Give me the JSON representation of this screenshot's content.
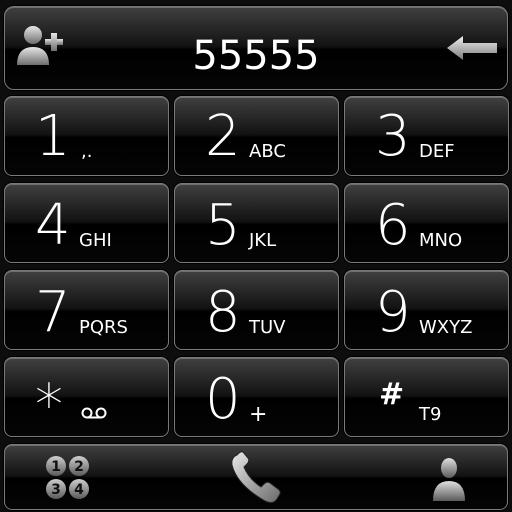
{
  "display": {
    "number": "55555",
    "add_contact_icon": "add-contact-icon",
    "backspace_icon": "backspace-arrow-icon"
  },
  "keys": [
    {
      "digit": "1",
      "letters": ",."
    },
    {
      "digit": "2",
      "letters": "ABC"
    },
    {
      "digit": "3",
      "letters": "DEF"
    },
    {
      "digit": "4",
      "letters": "GHI"
    },
    {
      "digit": "5",
      "letters": "JKL"
    },
    {
      "digit": "6",
      "letters": "MNO"
    },
    {
      "digit": "7",
      "letters": "PQRS"
    },
    {
      "digit": "8",
      "letters": "TUV"
    },
    {
      "digit": "9",
      "letters": "WXYZ"
    },
    {
      "digit": "*",
      "letters": "voicemail-icon"
    },
    {
      "digit": "0",
      "letters": "+"
    },
    {
      "digit": "#",
      "letters": "T9"
    }
  ],
  "bottom": {
    "dialpad_toggle_icon": "dialpad-1234-icon",
    "call_icon": "phone-handset-icon",
    "contacts_icon": "contact-person-icon"
  },
  "colors": {
    "text": "#ffffff",
    "key_border": "#7a7a7a",
    "background": "#0d0d0d"
  }
}
